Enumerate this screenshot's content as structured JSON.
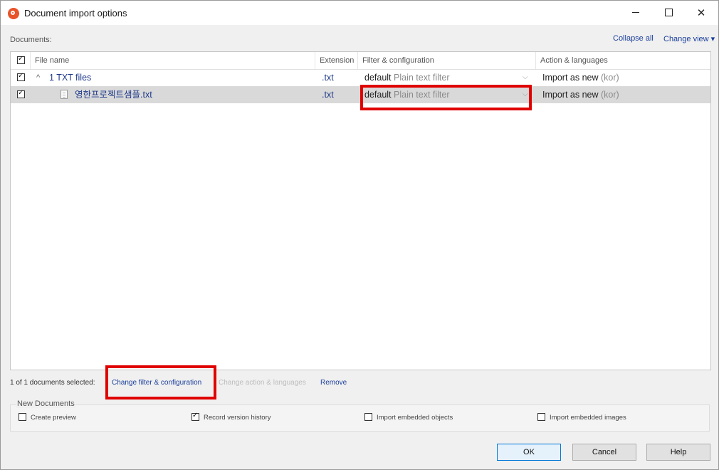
{
  "window": {
    "title": "Document import options"
  },
  "toolbar": {
    "documents_label": "Documents:",
    "collapse_all": "Collapse all",
    "change_view": "Change view ▾"
  },
  "grid": {
    "columns": [
      "File name",
      "Extension",
      "Filter & configuration",
      "Action & languages"
    ],
    "rows": [
      {
        "name": "1 TXT files",
        "extension": ".txt",
        "filter_default": "default",
        "filter_name": "Plain text filter",
        "action": "Import as new",
        "lang": "(kor)",
        "checked": true
      },
      {
        "name": "영한프로젝트샘플.txt",
        "extension": ".txt",
        "filter_default": "default",
        "filter_name": "Plain text filter",
        "action": "Import as new",
        "lang": "(kor)",
        "checked": true
      }
    ]
  },
  "selection": {
    "info": "1 of 1 documents selected:",
    "change_filter": "Change filter & configuration",
    "change_action": "Change action & languages",
    "remove": "Remove"
  },
  "new_documents": {
    "label": "New Documents",
    "options": [
      {
        "label": "Create preview",
        "checked": false
      },
      {
        "label": "Record version history",
        "checked": true
      },
      {
        "label": "Import embedded objects",
        "checked": false
      },
      {
        "label": "Import embedded images",
        "checked": false
      }
    ]
  },
  "buttons": {
    "ok": "OK",
    "cancel": "Cancel",
    "help": "Help"
  },
  "icons": [
    "app-logo-icon",
    "minimize-icon",
    "maximize-icon",
    "close-icon",
    "collapse-chevron-icon",
    "file-icon",
    "dropdown-arrow-icon",
    "checkbox-icon"
  ],
  "colors": {
    "link": "#1a3e9c",
    "highlight": "#e00000",
    "selected_row": "#d9d9d9"
  }
}
